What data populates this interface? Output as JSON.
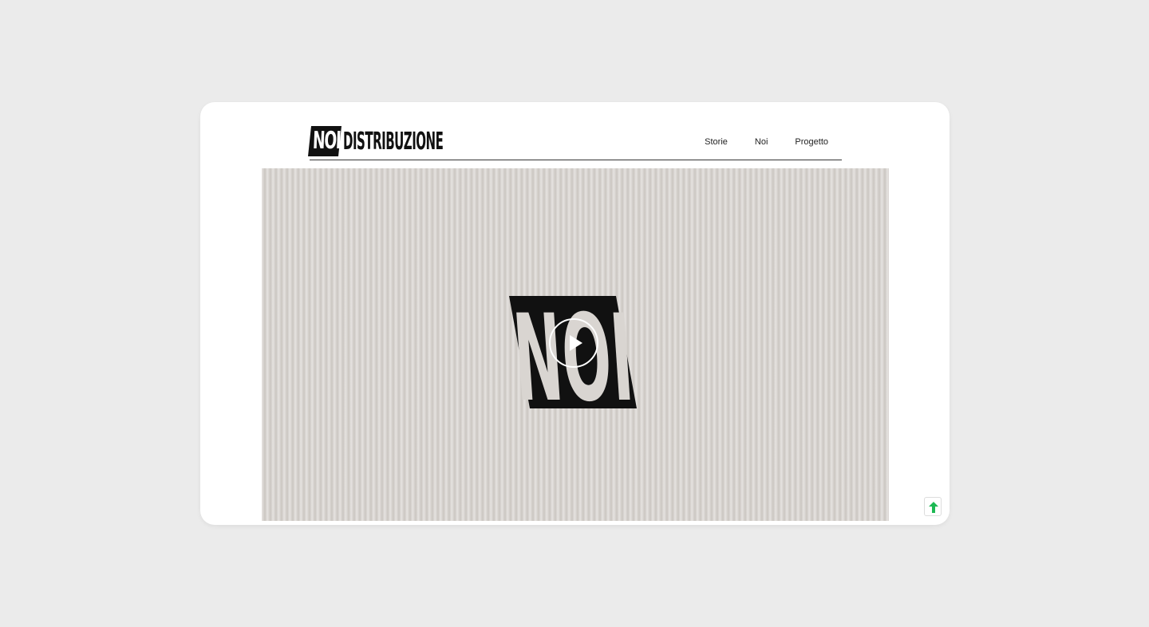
{
  "brand": {
    "badge": "NOI",
    "wordmark": "DISTRIBUZIONE"
  },
  "nav": {
    "items": [
      "Storie",
      "Noi",
      "Progetto"
    ]
  },
  "hero": {
    "video_logo_text": "NOI",
    "play_icon": "play-icon"
  },
  "scroll_top": {
    "icon": "arrow-up-icon",
    "color": "#1db954"
  },
  "colors": {
    "page_bg": "#ebebeb",
    "frame_bg": "#ffffff",
    "ink": "#111111",
    "paper": "#d9d5d1"
  }
}
